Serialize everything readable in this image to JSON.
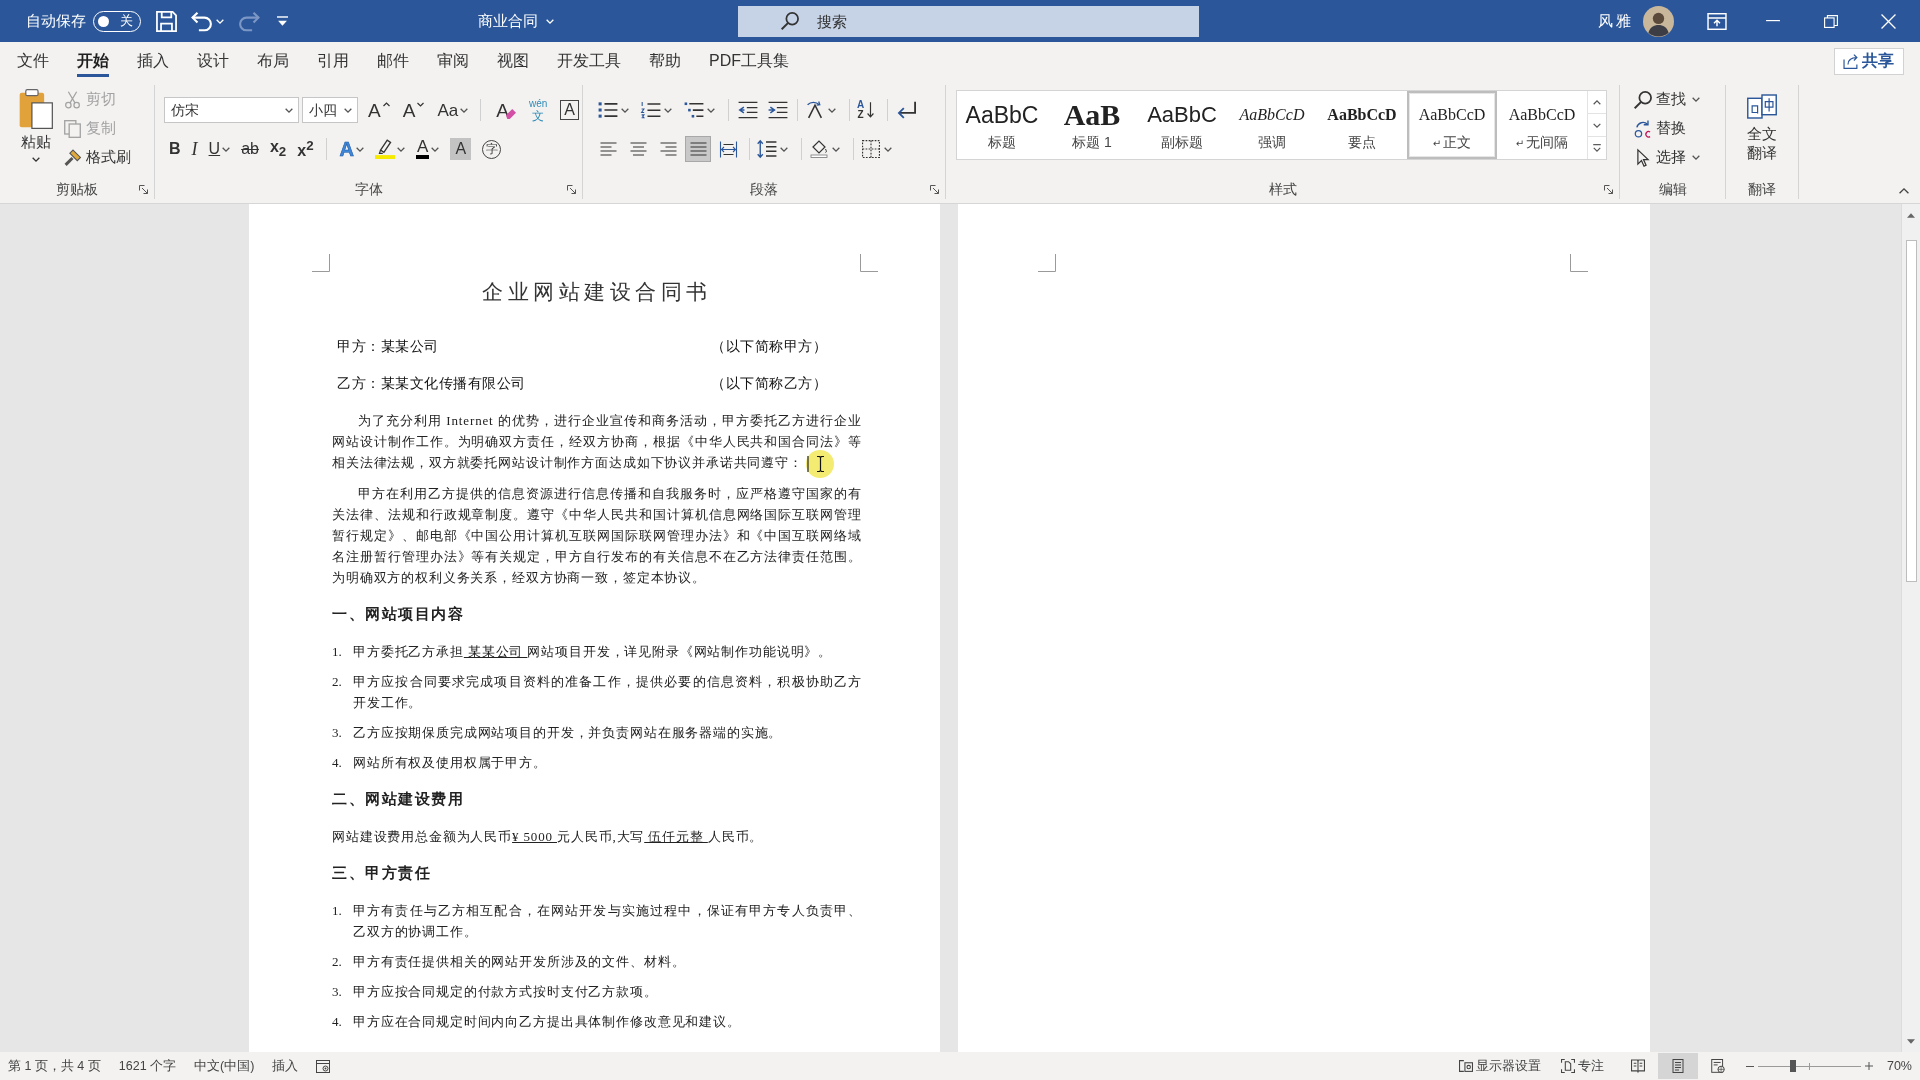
{
  "title_bar": {
    "autosave": {
      "label": "自动保存",
      "on": false,
      "state": "关"
    },
    "quick_access": [
      {
        "kind": "save",
        "menu": false,
        "disabled": false
      },
      {
        "kind": "undo",
        "menu": true,
        "disabled": false
      },
      {
        "kind": "redo",
        "menu": false,
        "disabled": true
      },
      {
        "kind": "customize",
        "menu": false,
        "disabled": false
      }
    ],
    "document_title": "商业合同",
    "search": {
      "placeholder": "搜索"
    },
    "user_name": "风雅"
  },
  "menu_tabs": [
    {
      "label": "文件",
      "selected": false
    },
    {
      "label": "开始",
      "selected": true
    },
    {
      "label": "插入",
      "selected": false
    },
    {
      "label": "设计",
      "selected": false
    },
    {
      "label": "布局",
      "selected": false
    },
    {
      "label": "引用",
      "selected": false
    },
    {
      "label": "邮件",
      "selected": false
    },
    {
      "label": "审阅",
      "selected": false
    },
    {
      "label": "视图",
      "selected": false
    },
    {
      "label": "开发工具",
      "selected": false
    },
    {
      "label": "帮助",
      "selected": false
    },
    {
      "label": "PDF工具集",
      "selected": false
    }
  ],
  "share_button": "共享",
  "ribbon": {
    "clipboard": {
      "label": "剪贴板",
      "paste": "粘贴",
      "items": [
        {
          "kind": "cut",
          "label": "剪切",
          "disabled": true
        },
        {
          "kind": "copy",
          "label": "复制",
          "disabled": true
        },
        {
          "kind": "format_painter",
          "label": "格式刷",
          "disabled": false
        }
      ]
    },
    "font": {
      "label": "字体",
      "font_name": "仿宋",
      "font_size": "小四",
      "row_1": [
        {
          "kind": "grow",
          "glyph": "A",
          "menu": false
        },
        {
          "kind": "shrink",
          "glyph": "A",
          "menu": false
        },
        {
          "kind": "case",
          "glyph": "Aa",
          "menu": true
        },
        {
          "kind": "clear",
          "glyph": "A",
          "menu": false
        },
        {
          "kind": "pinyin",
          "glyph": "wén",
          "glyph_2": "文",
          "menu": false
        },
        {
          "kind": "border",
          "glyph": "A",
          "menu": false
        }
      ],
      "row_2": [
        {
          "kind": "bold",
          "glyph": "B",
          "menu": false
        },
        {
          "kind": "italic",
          "glyph": "I",
          "menu": false
        },
        {
          "kind": "underline",
          "glyph": "U",
          "menu": true
        },
        {
          "kind": "strike",
          "glyph": "ab",
          "menu": false
        },
        {
          "kind": "subscript",
          "glyph": "x$_{2}$",
          "menu": false
        },
        {
          "kind": "superscript",
          "glyph": "x$^{2}$",
          "menu": false
        },
        {
          "kind": "effects",
          "glyph": "A",
          "menu": true
        },
        {
          "kind": "highlight",
          "menu": true
        },
        {
          "kind": "color",
          "glyph": "A",
          "menu": true
        },
        {
          "kind": "shading",
          "glyph": "A",
          "menu": false
        },
        {
          "kind": "enclose",
          "glyph": "字",
          "menu": false
        }
      ]
    },
    "paragraph": {
      "label": "段落",
      "row_1": [
        {
          "kind": "bullets",
          "menu": true
        },
        {
          "kind": "numbering",
          "menu": true
        },
        {
          "kind": "multilevel",
          "menu": true
        },
        {
          "kind": "outdent",
          "menu": false
        },
        {
          "kind": "indent",
          "menu": false
        },
        {
          "kind": "asian_layout",
          "menu": true
        },
        {
          "kind": "sort",
          "glyph": "A",
          "glyph_2": "Z",
          "menu": false
        },
        {
          "kind": "show_marks",
          "menu": false
        }
      ],
      "alignment": [
        {
          "kind": "align_left",
          "selected": false
        },
        {
          "kind": "align_center",
          "selected": false
        },
        {
          "kind": "align_right",
          "selected": false
        },
        {
          "kind": "justify",
          "selected": true
        },
        {
          "kind": "distributed",
          "selected": false
        }
      ],
      "row_2": [
        {
          "kind": "line_spacing",
          "menu": true
        },
        {
          "kind": "shading",
          "menu": true
        },
        {
          "kind": "borders",
          "menu": true
        }
      ]
    },
    "styles": {
      "label": "样式",
      "items": [
        {
          "kind": "title",
          "preview": "AaBbC",
          "label": "标题",
          "selected": false
        },
        {
          "kind": "heading_1",
          "preview": "AaB",
          "label": "标题 1",
          "selected": false
        },
        {
          "kind": "subtitle",
          "preview": "AaBbC",
          "label": "副标题",
          "selected": false
        },
        {
          "kind": "emphasis",
          "preview": "AaBbCcD",
          "label": "强调",
          "selected": false
        },
        {
          "kind": "strong",
          "preview": "AaBbCcD",
          "label": "要点",
          "selected": false
        },
        {
          "kind": "normal",
          "preview": "AaBbCcD",
          "mark": "↵",
          "label": "正文",
          "selected": true
        },
        {
          "kind": "no_spacing",
          "preview": "AaBbCcD",
          "mark": "↵",
          "label": "无间隔",
          "selected": false
        }
      ]
    },
    "editing": {
      "label": "编辑",
      "items": [
        {
          "kind": "find",
          "label": "查找",
          "menu": true
        },
        {
          "kind": "replace",
          "label": "替换",
          "menu": false
        },
        {
          "kind": "select",
          "label": "选择",
          "menu": true
        }
      ]
    },
    "translate": {
      "label": "翻译",
      "button": "全文翻译"
    }
  },
  "document": {
    "title": "企业网站建设合同书",
    "blocks": [
      {
        "kind": "party",
        "name": "甲方：某某公司",
        "note": "（以下简称甲方）"
      },
      {
        "kind": "party",
        "name": "乙方：某某文化传播有限公司",
        "note": "（以下简称乙方）"
      },
      {
        "kind": "paragraph",
        "cursor": true,
        "text": "为了充分利用 Internet 的优势，进行企业宣传和商务活动，甲方委托乙方进行企业网站设计制作工作。为明确双方责任，经双方协商，根据《中华人民共和国合同法》等相关法律法规，双方就委托网站设计制作方面达成如下协议并承诺共同遵守："
      },
      {
        "kind": "paragraph",
        "cursor": false,
        "text": "甲方在利用乙方提供的信息资源进行信息传播和自我服务时，应严格遵守国家的有关法律、法规和行政规章制度。遵守《中华人民共和国计算机信息网络国际互联网管理暂行规定》、邮电部《中国公用计算机互联网国际联网管理办法》和《中国互联网络域名注册暂行管理办法》等有关规定，甲方自行发布的有关信息不在乙方法律责任范围。为明确双方的权利义务关系，经双方协商一致，签定本协议。"
      },
      {
        "kind": "heading",
        "text": "一、网站项目内容"
      },
      {
        "kind": "list_item",
        "number": "1.",
        "parts": [
          {
            "text": "甲方委托乙方承担",
            "underline": false
          },
          {
            "text": " 某某公司 ",
            "underline": true
          },
          {
            "text": "网站项目开发，详见附录《网站制作功能说明》。",
            "underline": false
          }
        ]
      },
      {
        "kind": "list_item",
        "number": "2.",
        "text": "甲方应按合同要求完成项目资料的准备工作，提供必要的信息资料，积极协助乙方开发工作。"
      },
      {
        "kind": "list_item",
        "number": "3.",
        "text": "乙方应按期保质完成网站项目的开发，并负责网站在服务器端的实施。"
      },
      {
        "kind": "list_item",
        "number": "4.",
        "text": "网站所有权及使用权属于甲方。"
      },
      {
        "kind": "heading",
        "text": "二、网站建设费用"
      },
      {
        "kind": "clause",
        "cursor": false,
        "parts": [
          {
            "text": "网站建设费用总金额为人民币",
            "underline": false
          },
          {
            "text": "¥ 5000 ",
            "underline": true
          },
          {
            "text": "元人民币,大写",
            "underline": false
          },
          {
            "text": " 伍仟元整 ",
            "underline": true
          },
          {
            "text": "人民币。",
            "underline": false
          }
        ]
      },
      {
        "kind": "heading",
        "text": "三、甲方责任"
      },
      {
        "kind": "list_item",
        "number": "1.",
        "text": "甲方有责任与乙方相互配合，在网站开发与实施过程中，保证有甲方专人负责甲、乙双方的协调工作。"
      },
      {
        "kind": "list_item",
        "number": "2.",
        "text": "甲方有责任提供相关的网站开发所涉及的文件、材料。"
      },
      {
        "kind": "list_item",
        "number": "3.",
        "text": "甲方应按合同规定的付款方式按时支付乙方款项。"
      },
      {
        "kind": "list_item",
        "number": "4.",
        "text": "甲方应在合同规定时间内向乙方提出具体制作修改意见和建议。"
      }
    ]
  },
  "status_bar": {
    "page": "第 1 页，共 4 页",
    "words": "1621 个字",
    "language": "中文(中国)",
    "mode": "插入",
    "display_settings": "显示器设置",
    "focus": "专注",
    "views": [
      {
        "kind": "read",
        "selected": false
      },
      {
        "kind": "print",
        "selected": true
      },
      {
        "kind": "web",
        "selected": false
      }
    ],
    "zoom": {
      "level": 0.34,
      "percent": "70%"
    }
  }
}
